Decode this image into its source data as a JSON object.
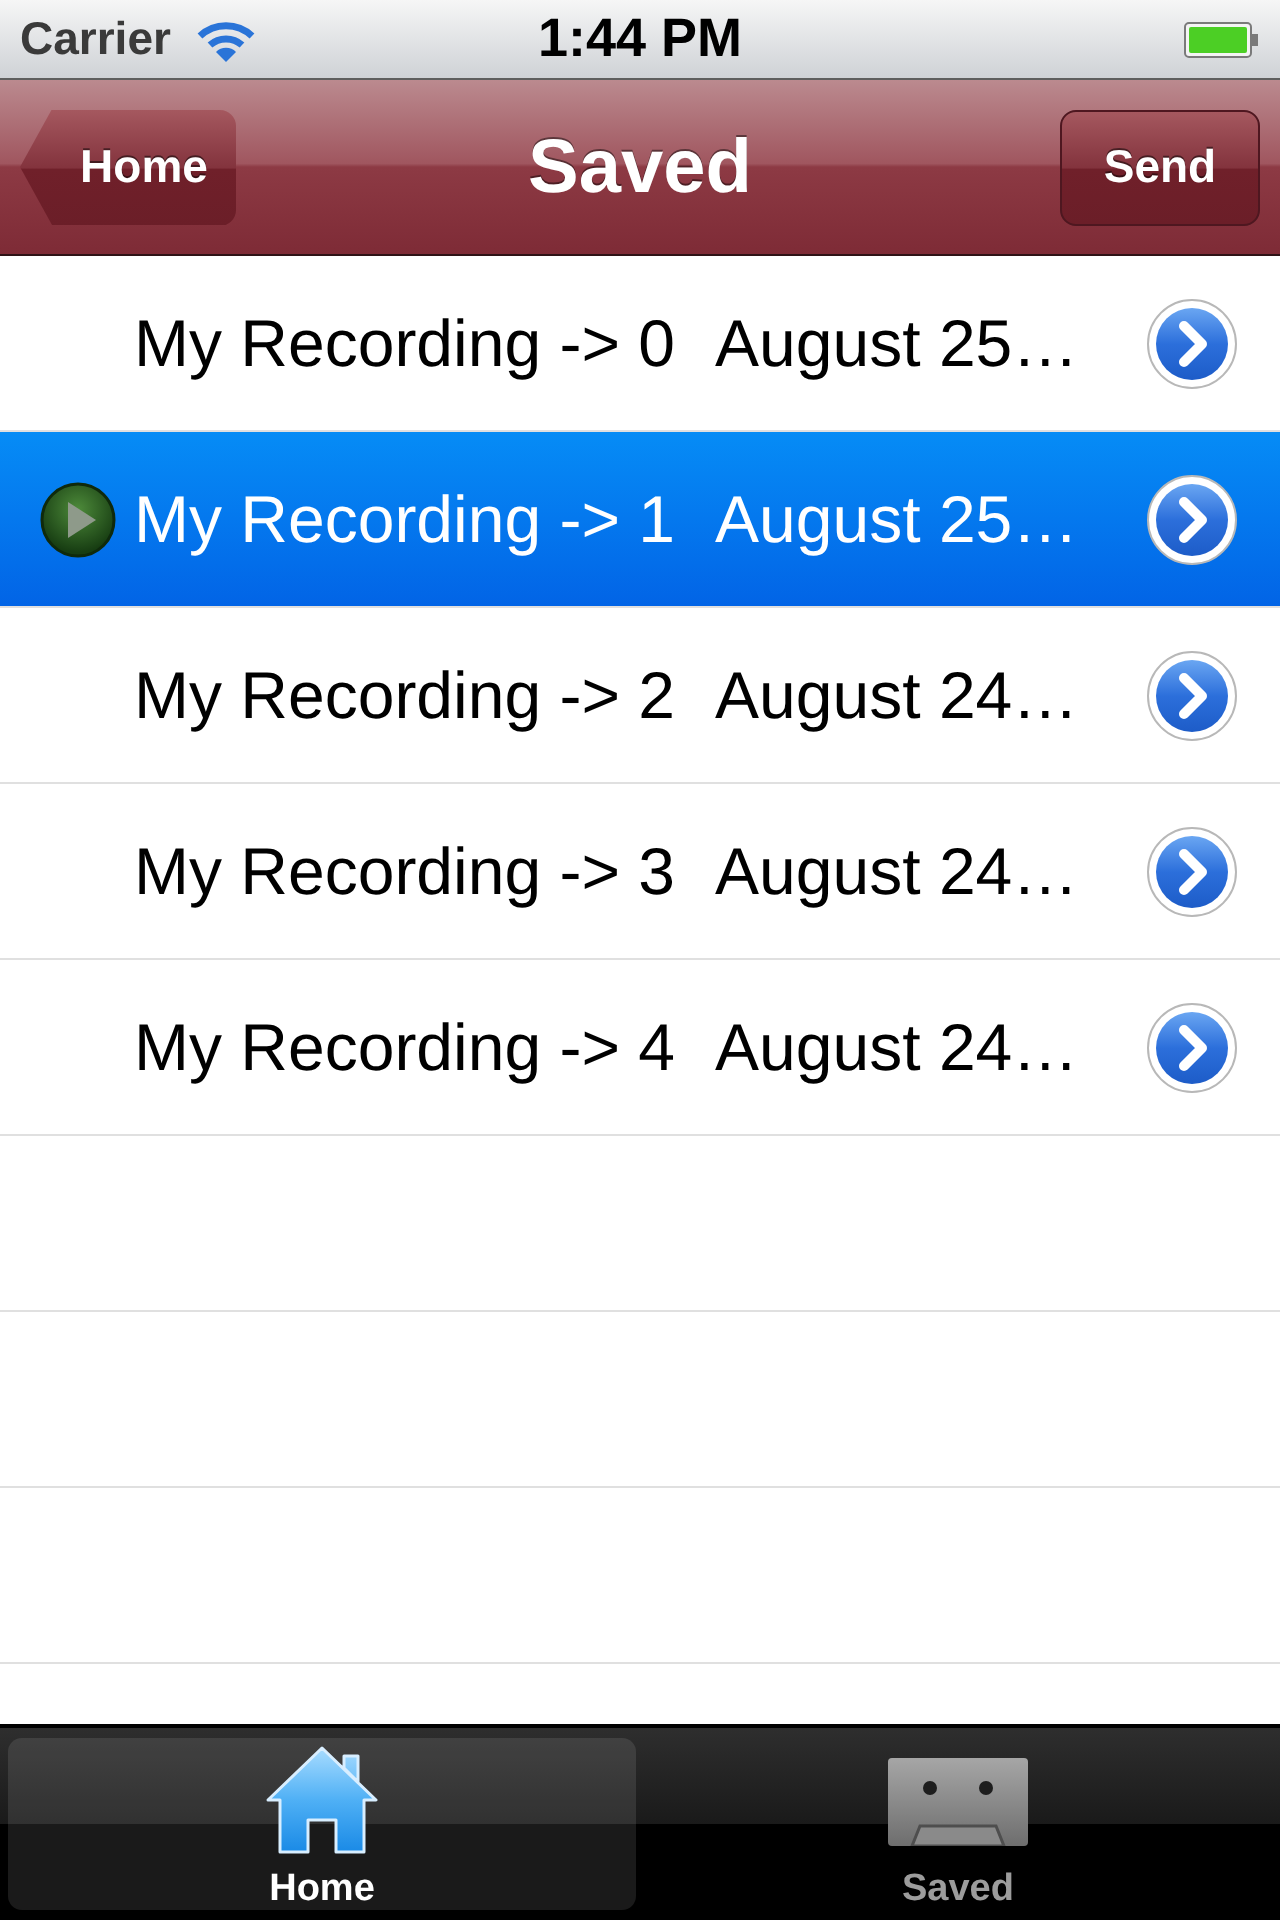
{
  "status_bar": {
    "carrier": "Carrier",
    "time": "1:44 PM"
  },
  "nav_bar": {
    "back_button": "Home",
    "title": "Saved",
    "action_button": "Send"
  },
  "recordings": [
    {
      "name": "My Recording -> 0",
      "date": "August 25…",
      "selected": false,
      "playing": false
    },
    {
      "name": "My Recording -> 1",
      "date": "August 25…",
      "selected": true,
      "playing": true
    },
    {
      "name": "My Recording -> 2",
      "date": "August 24…",
      "selected": false,
      "playing": false
    },
    {
      "name": "My Recording -> 3",
      "date": "August 24…",
      "selected": false,
      "playing": false
    },
    {
      "name": "My Recording -> 4",
      "date": "August 24…",
      "selected": false,
      "playing": false
    }
  ],
  "tab_bar": {
    "tabs": [
      {
        "label": "Home",
        "selected": true
      },
      {
        "label": "Saved",
        "selected": false
      }
    ]
  }
}
